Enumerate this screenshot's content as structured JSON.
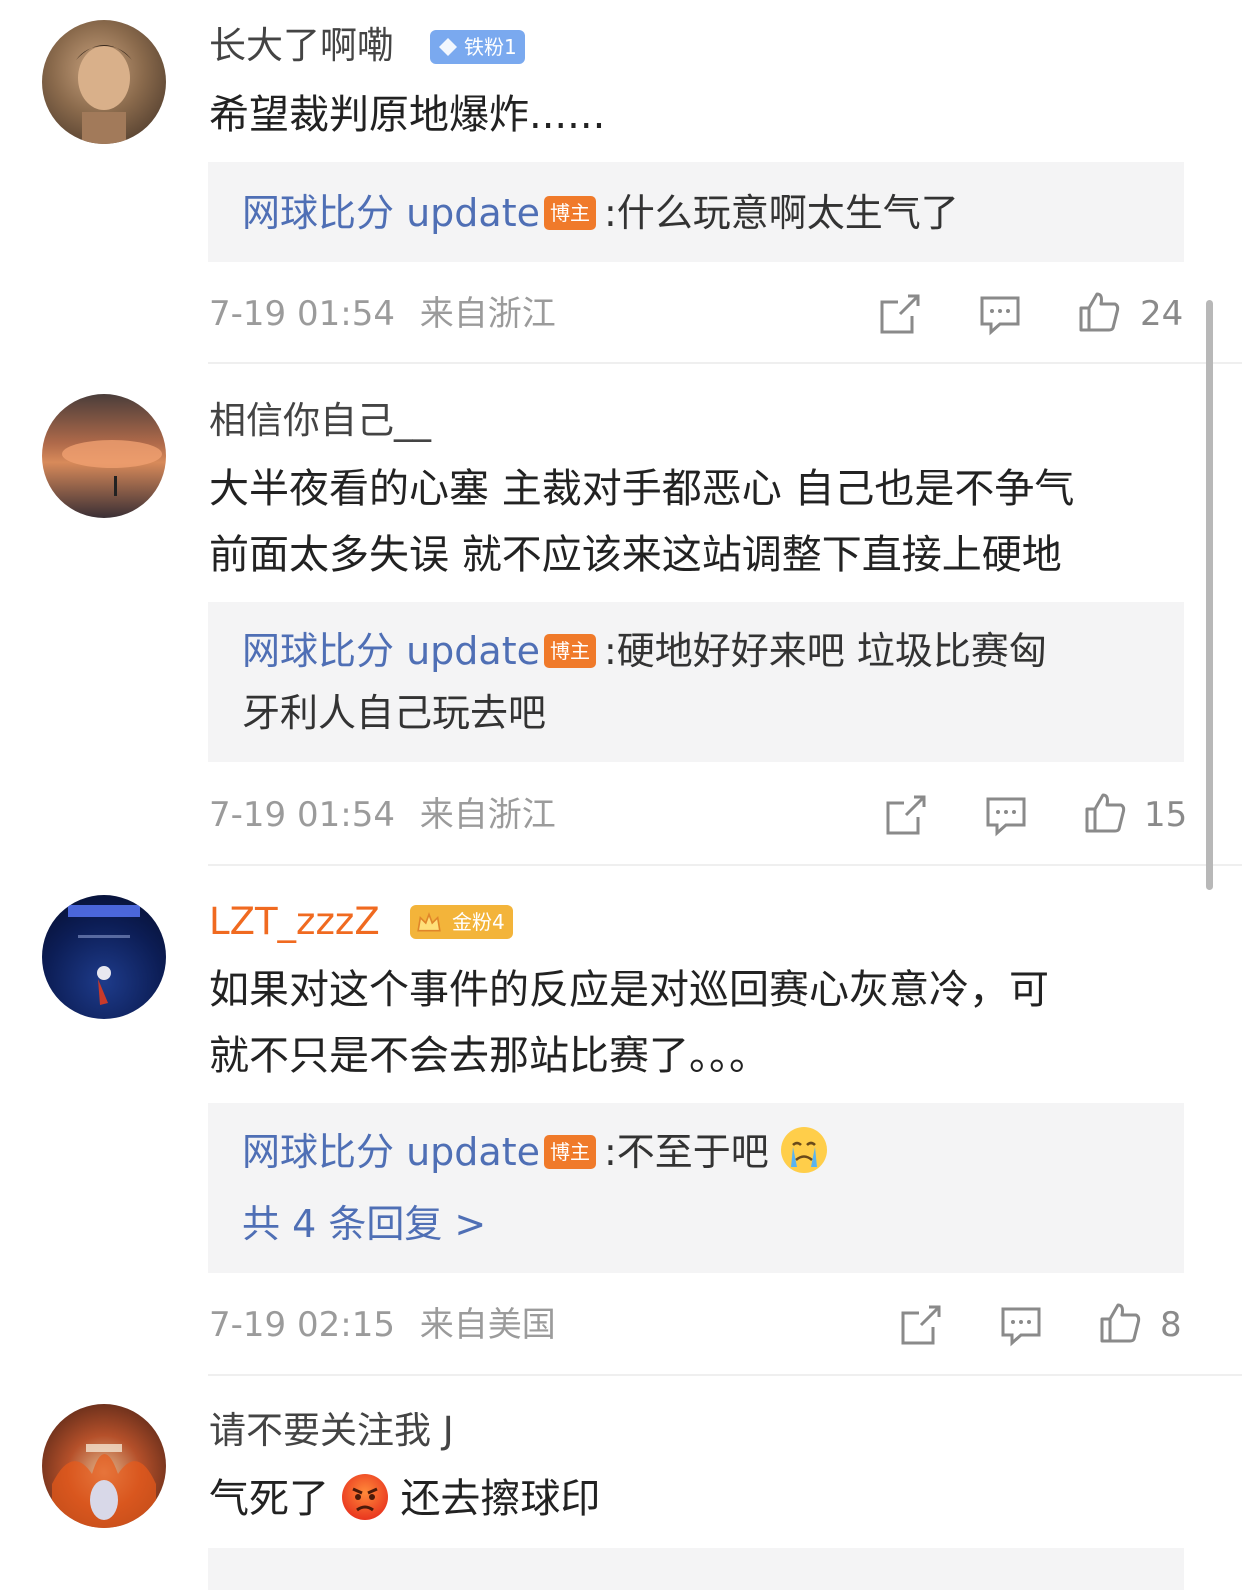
{
  "comments": [
    {
      "username": "长大了啊嘞",
      "badge": "铁粉1",
      "text": "希望裁判原地爆炸......",
      "reply": {
        "author": "网球比分 update",
        "tag": "博主",
        "lines": [
          ":什么玩意啊太生气了"
        ]
      },
      "time": "7-19 01:54",
      "location": "来自浙江",
      "likes": "24"
    },
    {
      "username": "相信你自己__",
      "text": "大半夜看的心塞 主裁对手都恶心 自己也是不争气\n前面太多失误 就不应该来这站调整下直接上硬地",
      "reply": {
        "author": "网球比分 update",
        "tag": "博主",
        "lines": [
          ":硬地好好来吧 垃圾比赛匈",
          "牙利人自己玩去吧"
        ]
      },
      "time": "7-19 01:54",
      "location": "来自浙江",
      "likes": "15"
    },
    {
      "username": "LZT_zzzZ",
      "badge": "金粉4",
      "text": "如果对这个事件的反应是对巡回赛心灰意冷，可\n就不只是不会去那站比赛了。。。",
      "reply": {
        "author": "网球比分 update",
        "tag": "博主",
        "lines": [
          ":不至于吧"
        ],
        "more": "共 4 条回复 >"
      },
      "time": "7-19 02:15",
      "location": "来自美国",
      "likes": "8"
    },
    {
      "username": "请不要关注我 J",
      "text_before": "气死了",
      "text_after": " 还去擦球印"
    }
  ]
}
